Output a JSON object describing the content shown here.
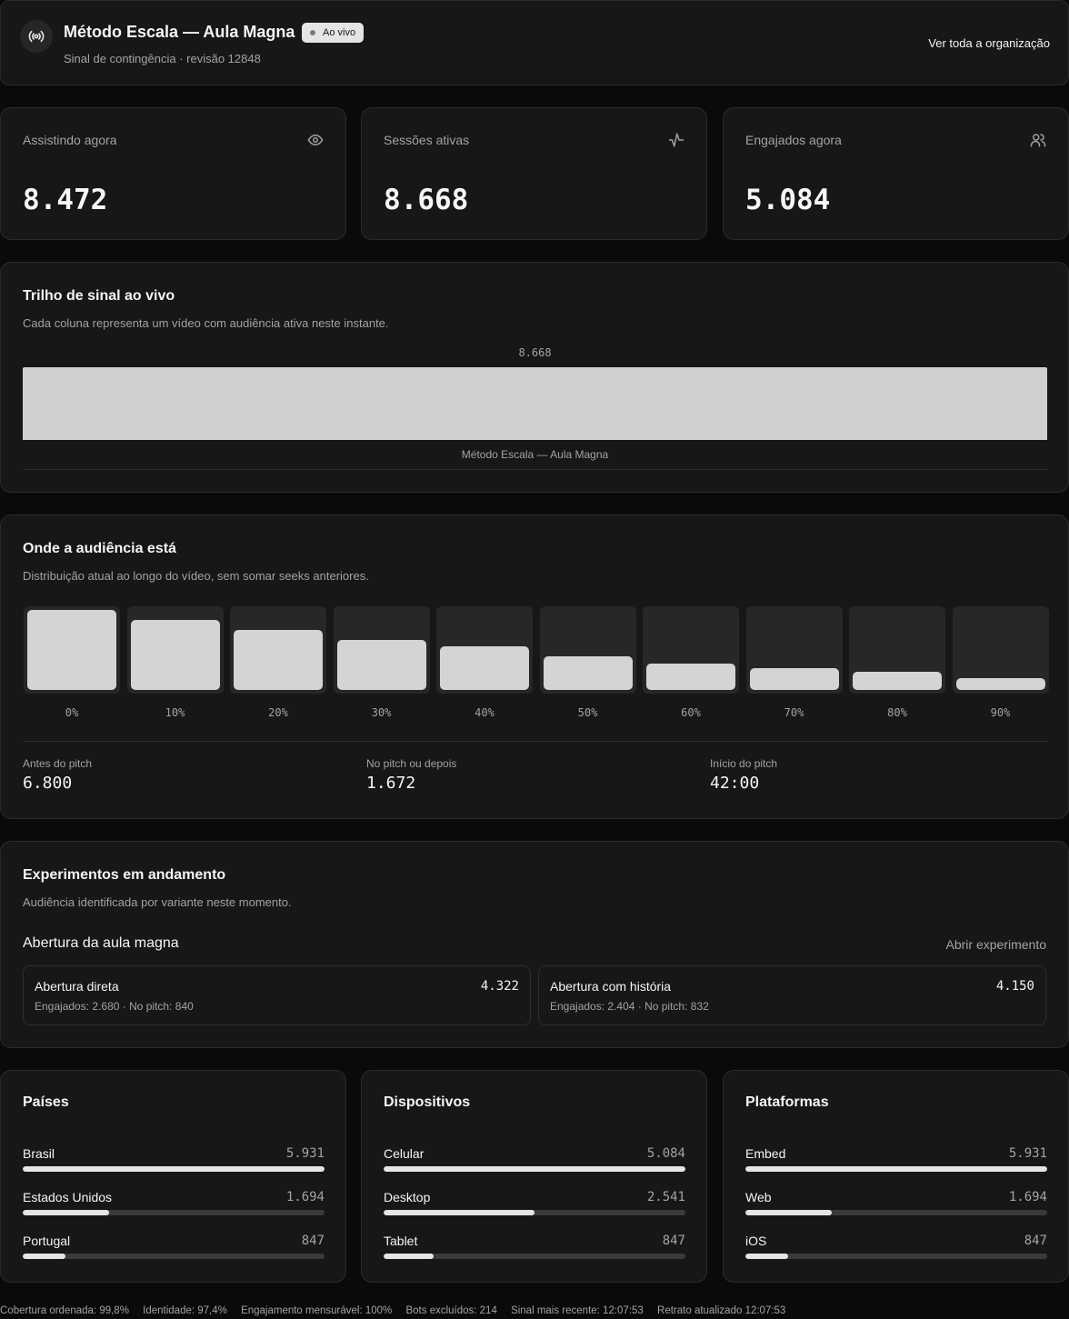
{
  "header": {
    "title": "Método Escala — Aula Magna",
    "badge": "Ao vivo",
    "subtitle": "Sinal de contingência · revisão 12848",
    "link": "Ver toda a organização"
  },
  "stats": [
    {
      "label": "Assistindo agora",
      "value": "8.472",
      "icon": "eye-icon"
    },
    {
      "label": "Sessões ativas",
      "value": "8.668",
      "icon": "activity-icon"
    },
    {
      "label": "Engajados agora",
      "value": "5.084",
      "icon": "users-icon"
    }
  ],
  "trail": {
    "title": "Trilho de sinal ao vivo",
    "subtitle": "Cada coluna representa um vídeo com audiência ativa neste instante.",
    "value": "8.668",
    "video": "Método Escala — Aula Magna"
  },
  "distribution": {
    "title": "Onde a audiência está",
    "subtitle": "Distribuição atual ao longo do vídeo, sem somar seeks anteriores.",
    "chart_data": {
      "type": "bar",
      "categories": [
        "0%",
        "10%",
        "20%",
        "30%",
        "40%",
        "50%",
        "60%",
        "70%",
        "80%",
        "90%"
      ],
      "values": [
        1.0,
        0.875,
        0.75,
        0.625,
        0.55,
        0.42,
        0.33,
        0.27,
        0.23,
        0.15
      ]
    },
    "kpis": [
      {
        "label": "Antes do pitch",
        "value": "6.800"
      },
      {
        "label": "No pitch ou depois",
        "value": "1.672"
      },
      {
        "label": "Início do pitch",
        "value": "42:00"
      }
    ]
  },
  "experiments": {
    "title": "Experimentos em andamento",
    "subtitle": "Audiência identificada por variante neste momento.",
    "name": "Abertura da aula magna",
    "link": "Abrir experimento",
    "variants": [
      {
        "name": "Abertura direta",
        "value": "4.322",
        "meta": "Engajados: 2.680 · No pitch: 840"
      },
      {
        "name": "Abertura com história",
        "value": "4.150",
        "meta": "Engajados: 2.404 · No pitch: 832"
      }
    ]
  },
  "breakdowns": [
    {
      "title": "Países",
      "rows": [
        {
          "label": "Brasil",
          "value": "5.931",
          "share": 1.0
        },
        {
          "label": "Estados Unidos",
          "value": "1.694",
          "share": 0.285
        },
        {
          "label": "Portugal",
          "value": "847",
          "share": 0.143
        }
      ]
    },
    {
      "title": "Dispositivos",
      "rows": [
        {
          "label": "Celular",
          "value": "5.084",
          "share": 1.0
        },
        {
          "label": "Desktop",
          "value": "2.541",
          "share": 0.5
        },
        {
          "label": "Tablet",
          "value": "847",
          "share": 0.167
        }
      ]
    },
    {
      "title": "Plataformas",
      "rows": [
        {
          "label": "Embed",
          "value": "5.931",
          "share": 1.0
        },
        {
          "label": "Web",
          "value": "1.694",
          "share": 0.285
        },
        {
          "label": "iOS",
          "value": "847",
          "share": 0.143
        }
      ]
    }
  ],
  "footer": [
    "Cobertura ordenada: 99,8%",
    "Identidade: 97,4%",
    "Engajamento mensurável: 100%",
    "Bots excluídos: 214",
    "Sinal mais recente: 12:07:53",
    "Retrato atualizado 12:07:53"
  ]
}
